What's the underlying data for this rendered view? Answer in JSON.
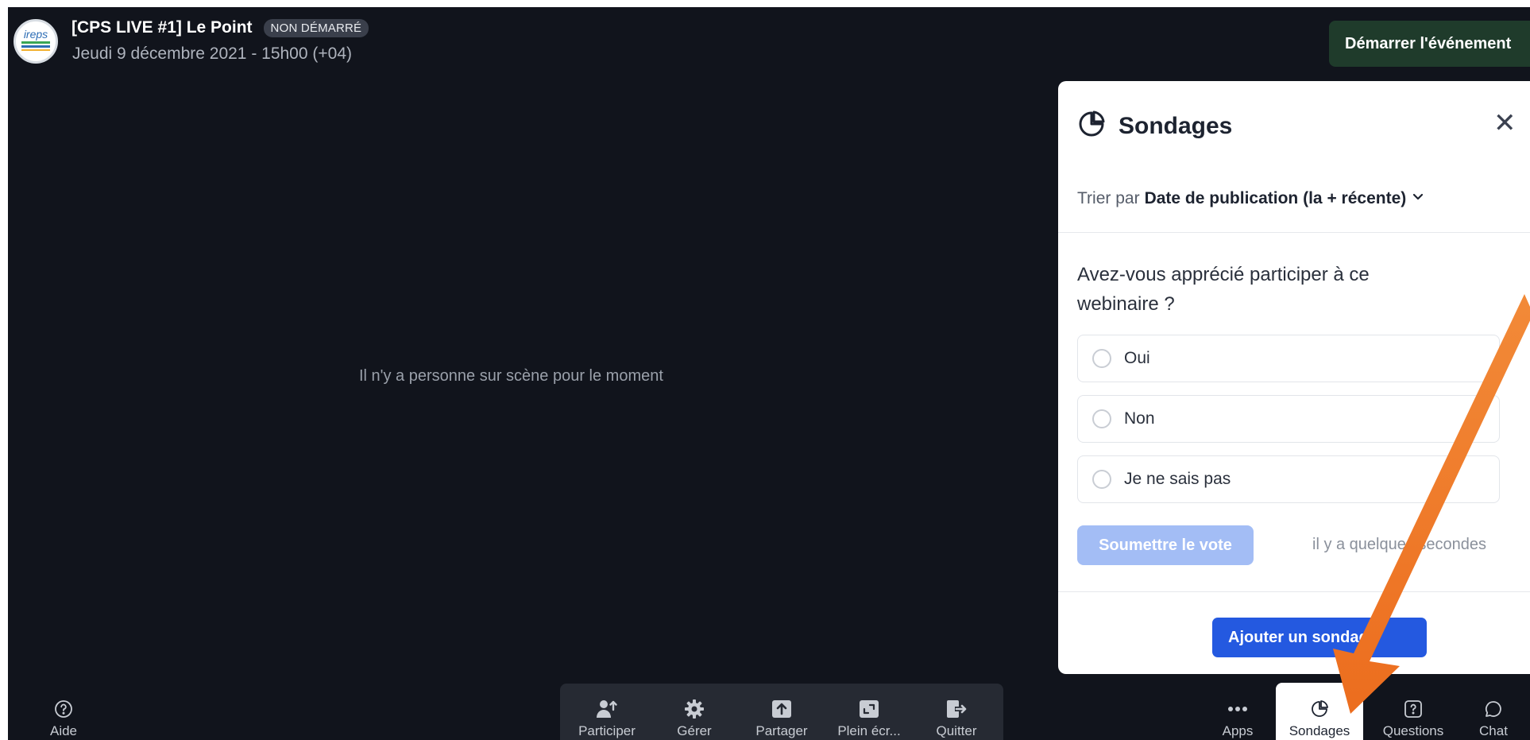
{
  "event": {
    "title": "[CPS LIVE #1] Le Point",
    "status_badge": "NON DÉMARRÉ",
    "date": "Jeudi 9 décembre 2021 - 15h00 (+04)",
    "logo_text": "ireps",
    "start_button": "Démarrer l'événement"
  },
  "stage": {
    "empty_message": "Il n'y a personne sur scène pour le moment"
  },
  "polls_panel": {
    "title": "Sondages",
    "sort_label": "Trier par",
    "sort_value": "Date de publication (la + récente)",
    "question": "Avez-vous apprécié participer à ce webinaire ?",
    "options": [
      "Oui",
      "Non",
      "Je ne sais pas"
    ],
    "submit_label": "Soumettre le vote",
    "timestamp": "il y a quelques secondes",
    "add_button": "Ajouter un sondage"
  },
  "toolbar": {
    "help": "Aide",
    "center": [
      "Participer",
      "Gérer",
      "Partager",
      "Plein écr...",
      "Quitter"
    ],
    "right": [
      "Apps",
      "Sondages",
      "Questions",
      "Chat"
    ],
    "active": "Sondages"
  },
  "colors": {
    "stage_bg": "#11141c",
    "start_button_bg": "#1f3b2b",
    "primary_blue": "#2459e0",
    "submit_disabled": "#a3bdf5",
    "annotation_arrow": "#f07b27"
  }
}
